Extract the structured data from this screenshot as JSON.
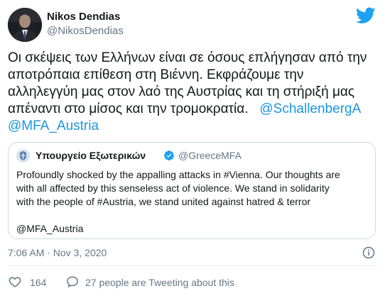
{
  "author": {
    "display_name": "Nikos Dendias",
    "handle": "@NikosDendias",
    "avatar_icon": "person-portrait-avatar"
  },
  "tweet": {
    "lines": [
      "Οι σκέψεις των Ελλήνων είναι σε όσους επλήγησαν από την",
      "αποτρόπαια επίθεση στη Βιέννη. Εκφράζουμε την",
      "αλληλεγγύη μας στον λαό της Αυστρίας και τη στήριξή μας",
      "απέναντι στο μίσος και την τρομοκρατία."
    ],
    "mention_1": "@SchallenbergA",
    "mention_2": "@MFA_Austria"
  },
  "quoted_tweet": {
    "display_name": "Υπουργείο Εξωτερικών",
    "handle": "@GreeceMFA",
    "verified": true,
    "lines": [
      "Profoundly shocked by the appalling attacks in #Vienna. Our thoughts are",
      "with all affected by this senseless act of violence. We stand in solidarity",
      "with the people of #Austria, we stand united against hatred & terror"
    ],
    "footer_line": "@MFA_Austria"
  },
  "meta": {
    "timestamp": "7:06 AM · Nov 3, 2020",
    "likes": "164",
    "people_text": "27 people are Tweeting about this"
  },
  "colors": {
    "twitter_blue": "#1da1f2",
    "link_blue": "#1b95e0",
    "secondary_text": "#657786",
    "border": "#cfd9de"
  }
}
